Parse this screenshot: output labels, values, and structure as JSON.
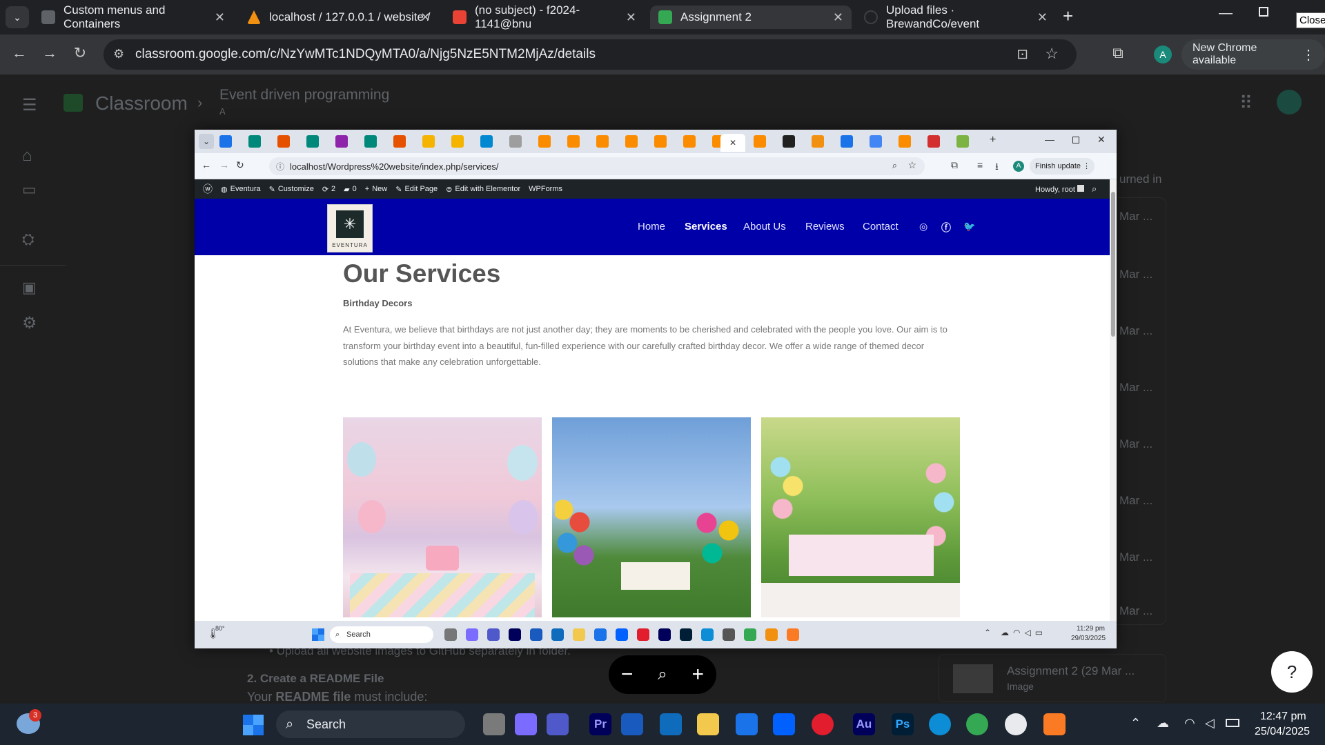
{
  "browser": {
    "tabs": [
      {
        "title": "Custom menus and Containers",
        "color": "#5f6368"
      },
      {
        "title": "localhost / 127.0.0.1 / website /",
        "color": "#f29111"
      },
      {
        "title": "(no subject) - f2024-1141@bnu",
        "color": "#ea4335"
      },
      {
        "title": "Assignment 2",
        "color": "#34a853"
      },
      {
        "title": "Upload files · BrewandCo/event",
        "color": "#202124"
      }
    ],
    "new_tab": "+",
    "url": "classroom.google.com/c/NzYwMTc1NDQyMTA0/a/Njg5NzE5NTM2MjAz/details",
    "profile_initial": "A",
    "update_label": "New Chrome available",
    "close_tooltip": "Close"
  },
  "classroom": {
    "app_name": "Classroom",
    "course_title": "Event driven programming",
    "course_sub": "A",
    "right_heading": "urned in",
    "right_items": [
      "Mar ...",
      "Mar ...",
      "Mar ...",
      "Mar ...",
      "Mar ...",
      "Mar ...",
      "Mar ...",
      "Mar ..."
    ],
    "attachment_title": "Assignment 2 (29 Mar ...",
    "attachment_type": "Image",
    "body_bullet": "Upload all website images to GitHub separately in folder.",
    "body_heading": "2. Create a README File",
    "body_line_prefix": "Your ",
    "body_line_bold": "README file",
    "body_line_suffix": " must include:"
  },
  "inner_browser": {
    "url": "localhost/Wordpress%20website/index.php/services/",
    "profile_initial": "A",
    "update_label": "Finish update",
    "wp_bar": {
      "site": "Eventura",
      "customize": "Customize",
      "updates": "2",
      "comments": "0",
      "new": "New",
      "edit_page": "Edit Page",
      "elementor": "Edit with Elementor",
      "wpforms": "WPForms",
      "howdy": "Howdy, root"
    },
    "site": {
      "logo_text": "EVENTURA",
      "nav": [
        "Home",
        "Services",
        "About Us",
        "Reviews",
        "Contact"
      ],
      "active_nav": "Services",
      "heading": "Our Services",
      "subheading": "Birthday Decors",
      "paragraph": "At Eventura, we believe that birthdays are not just another day; they are moments to be cherished and celebrated with the people you love. Our aim is to transform your birthday event into a beautiful, fun-filled experience with our carefully crafted birthday decor. We offer a wide range of themed decor solutions that make any celebration unforgettable.",
      "photos": [
        {
          "alt": "pastel birthday cake table with balloons"
        },
        {
          "alt": "outdoor balloon party setup"
        },
        {
          "alt": "garden birthday picnic with bunting"
        }
      ]
    },
    "taskbar": {
      "weather": "80°",
      "search": "Search",
      "time": "11:29 pm",
      "date": "29/03/2025"
    }
  },
  "zoom_controls": {
    "minus": "−",
    "plus": "+"
  },
  "help_label": "?",
  "taskbar": {
    "weather_badge": "3",
    "search": "Search",
    "time": "12:47 pm",
    "date": "25/04/2025",
    "apps": [
      "Pr",
      "Au",
      "Ps"
    ]
  }
}
